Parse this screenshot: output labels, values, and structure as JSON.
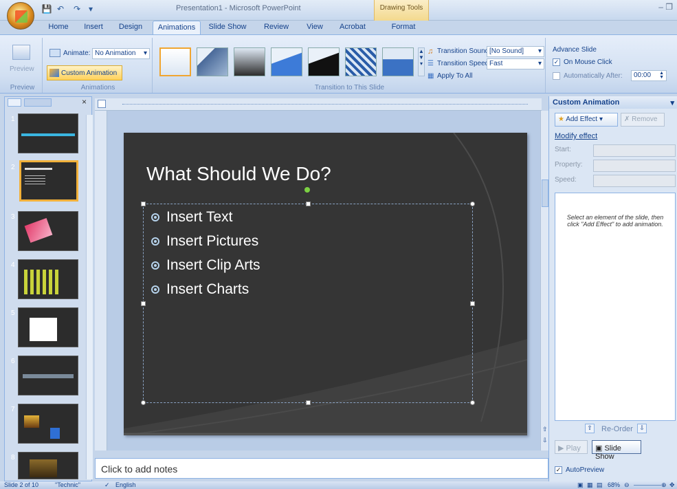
{
  "window": {
    "title": "Presentation1 - Microsoft PowerPoint",
    "contextual_tab_group": "Drawing Tools",
    "controls": "– ❐"
  },
  "tabs": [
    {
      "label": "Home"
    },
    {
      "label": "Insert"
    },
    {
      "label": "Design"
    },
    {
      "label": "Animations"
    },
    {
      "label": "Slide Show"
    },
    {
      "label": "Review"
    },
    {
      "label": "View"
    },
    {
      "label": "Acrobat"
    },
    {
      "label": "Format"
    }
  ],
  "ribbon": {
    "preview_group": {
      "button": "Preview",
      "label": "Preview"
    },
    "animations_group": {
      "animate_label": "Animate:",
      "animate_value": "No Animation",
      "custom_animation": "Custom Animation",
      "label": "Animations"
    },
    "transition_group": {
      "sound_label": "Transition Sound:",
      "sound_value": "[No Sound]",
      "speed_label": "Transition Speed:",
      "speed_value": "Fast",
      "apply_all": "Apply To All",
      "label": "Transition to This Slide"
    },
    "advance_group": {
      "title": "Advance Slide",
      "on_click": "On Mouse Click",
      "on_click_checked": true,
      "auto_after": "Automatically After:",
      "auto_after_checked": false,
      "auto_time": "00:00"
    }
  },
  "slides_pane": {
    "thumbnails": [
      {
        "number": "1",
        "selected": false
      },
      {
        "number": "2",
        "selected": true
      },
      {
        "number": "3",
        "selected": false
      },
      {
        "number": "4",
        "selected": false
      },
      {
        "number": "5",
        "selected": false
      },
      {
        "number": "6",
        "selected": false
      },
      {
        "number": "7",
        "selected": false
      },
      {
        "number": "8",
        "selected": false
      }
    ]
  },
  "slide": {
    "title": "What Should We Do?",
    "bullets": [
      "Insert Text",
      "Insert Pictures",
      "Insert Clip Arts",
      "Insert Charts"
    ]
  },
  "notes": {
    "placeholder": "Click to add notes"
  },
  "custom_animation_pane": {
    "title": "Custom Animation",
    "add_effect": "Add Effect",
    "remove": "Remove",
    "modify_effect": "Modify effect",
    "start_label": "Start:",
    "property_label": "Property:",
    "speed_label": "Speed:",
    "hint": "Select an element of the slide, then click \"Add Effect\" to add animation.",
    "reorder": "Re-Order",
    "play": "Play",
    "slide_show": "Slide Show",
    "autopreview": "AutoPreview",
    "autopreview_checked": true
  },
  "status_bar": {
    "slide_info": "Slide 2 of 10",
    "theme": "\"Technic\"",
    "language": "English",
    "zoom": "68%"
  }
}
